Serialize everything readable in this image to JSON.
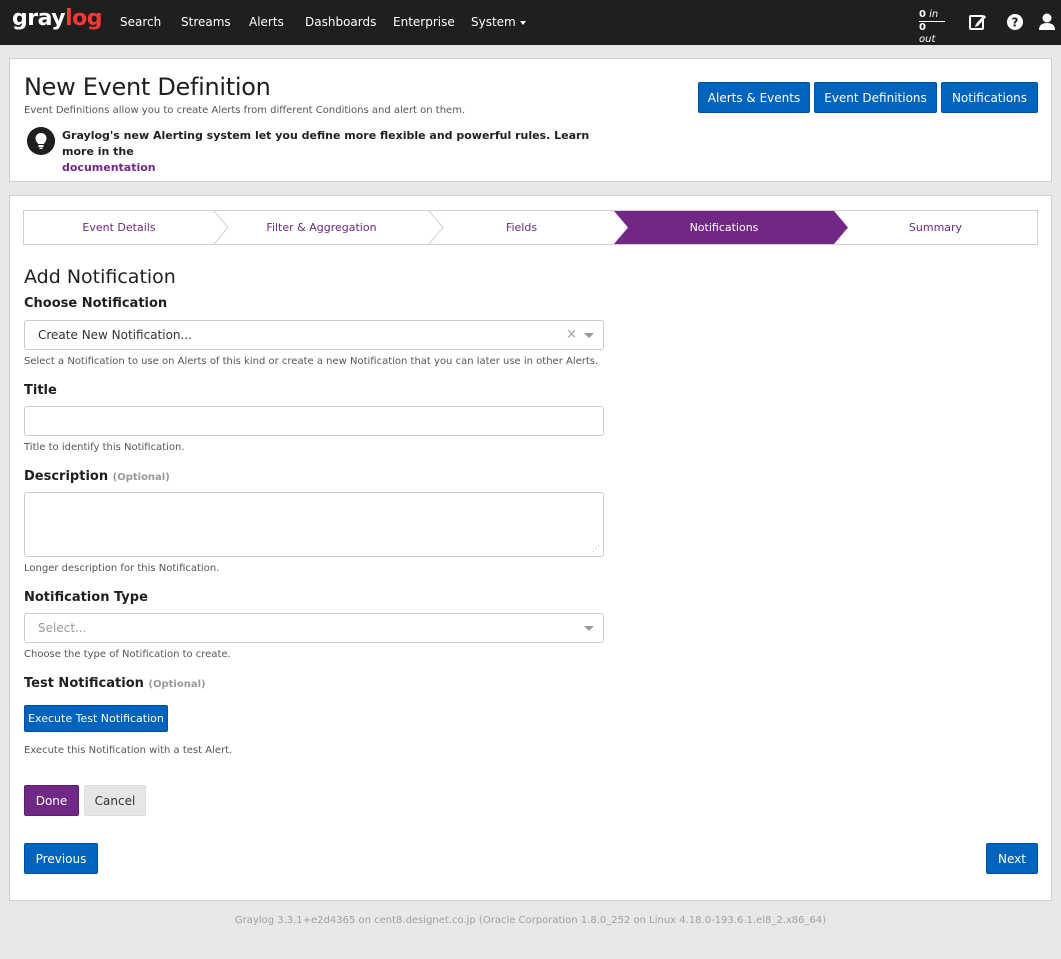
{
  "nav": {
    "brand_main": "gray",
    "brand_accent": "log",
    "items": [
      "Search",
      "Streams",
      "Alerts",
      "Dashboards",
      "Enterprise",
      "System"
    ],
    "throughput_in": "0",
    "throughput_in_unit": "in",
    "throughput_out": "0",
    "throughput_out_unit": "out",
    "icons": [
      "edit-icon",
      "help-icon",
      "user-icon"
    ]
  },
  "header": {
    "title": "New Event Definition",
    "description": "Event Definitions allow you to create Alerts from different Conditions and alert on them.",
    "tip_text": "Graylog's new Alerting system let you define more flexible and powerful rules. Learn more in the",
    "tip_link": "documentation",
    "buttons": [
      "Alerts & Events",
      "Event Definitions",
      "Notifications"
    ]
  },
  "wizard": {
    "steps": [
      "Event Details",
      "Filter & Aggregation",
      "Fields",
      "Notifications",
      "Summary"
    ],
    "active_step": "Notifications"
  },
  "form": {
    "section_title": "Add Notification",
    "choose_label": "Choose Notification",
    "choose_value": "Create New Notification...",
    "choose_clear": "×",
    "choose_help": "Select a Notification to use on Alerts of this kind or create a new Notification that you can later use in other Alerts.",
    "title_label": "Title",
    "title_value": "",
    "title_help": "Title to identify this Notification.",
    "description_label": "Description",
    "optional_text": "(Optional)",
    "description_value": "",
    "description_help": "Longer description for this Notification.",
    "type_label": "Notification Type",
    "type_placeholder": "Select...",
    "type_help": "Choose the type of Notification to create.",
    "test_label": "Test Notification",
    "test_button": "Execute Test Notification",
    "test_help": "Execute this Notification with a test Alert.",
    "done_button": "Done",
    "cancel_button": "Cancel"
  },
  "pager": {
    "previous_button": "Previous",
    "next_button": "Next"
  },
  "footer": {
    "text": "Graylog 3.3.1+e2d4365 on cent8.designet.co.jp (Oracle Corporation 1.8.0_252 on Linux 4.18.0-193.6.1.el8_2.x86_64)"
  },
  "colors": {
    "navbar": "#1f1f1f",
    "brand_accent": "#ff3633",
    "primary_blue": "#0063be",
    "purple": "#702785",
    "page_bg": "#e8e8e8"
  }
}
